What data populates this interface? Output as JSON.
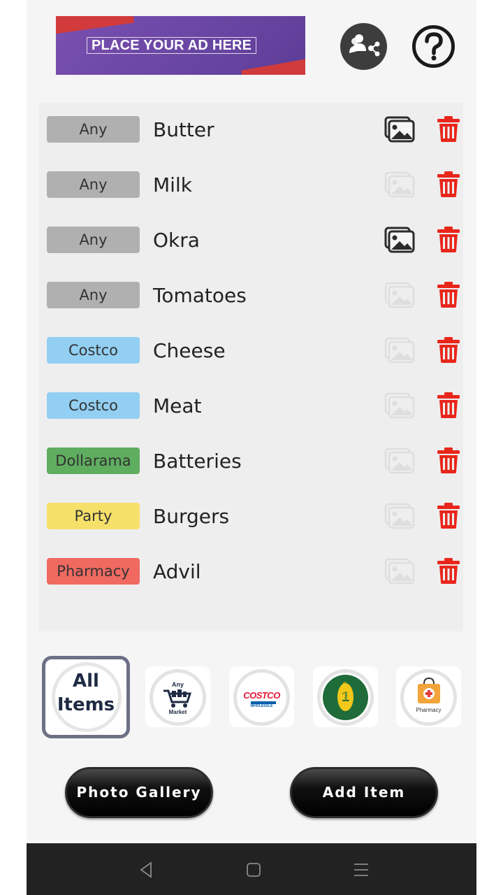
{
  "header": {
    "ad_text": "PLACE YOUR AD HERE",
    "share_icon": "share-users-icon",
    "help_icon": "help-icon"
  },
  "items": [
    {
      "tag": "Any",
      "tag_color": "#b0b0b0",
      "name": "Butter",
      "has_photo": true
    },
    {
      "tag": "Any",
      "tag_color": "#b0b0b0",
      "name": "Milk",
      "has_photo": false
    },
    {
      "tag": "Any",
      "tag_color": "#b0b0b0",
      "name": "Okra",
      "has_photo": true
    },
    {
      "tag": "Any",
      "tag_color": "#b0b0b0",
      "name": "Tomatoes",
      "has_photo": false
    },
    {
      "tag": "Costco",
      "tag_color": "#92cff2",
      "name": "Cheese",
      "has_photo": false
    },
    {
      "tag": "Costco",
      "tag_color": "#92cff2",
      "name": "Meat",
      "has_photo": false
    },
    {
      "tag": "Dollarama",
      "tag_color": "#5fad5f",
      "name": "Batteries",
      "has_photo": false
    },
    {
      "tag": "Party",
      "tag_color": "#f5e06a",
      "name": "Burgers",
      "has_photo": false
    },
    {
      "tag": "Pharmacy",
      "tag_color": "#f06a62",
      "name": "Advil",
      "has_photo": false
    }
  ],
  "stores": {
    "all_line1": "All",
    "all_line2": "Items",
    "any_line1": "Any",
    "any_line2": "Market",
    "costco_logo": "COSTCO",
    "costco_sub": "WHOLESALE",
    "dollarama_logo": "DOLLARAMA",
    "pharmacy_label": "Pharmacy"
  },
  "buttons": {
    "photo_gallery": "Photo Gallery",
    "add_item": "Add Item"
  },
  "colors": {
    "trash": "#e8261b",
    "photo_active": "#2b2b2b",
    "photo_inactive": "#dedede"
  }
}
